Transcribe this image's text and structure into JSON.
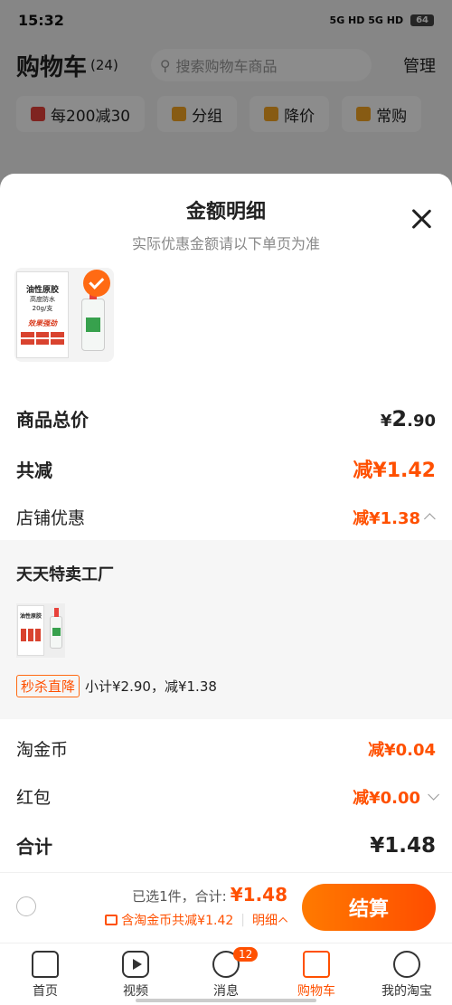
{
  "status": {
    "time": "15:32",
    "signal": "5G HD 5G HD",
    "battery": "64"
  },
  "background": {
    "title": "购物车",
    "count": "(24)",
    "search_placeholder": "搜索购物车商品",
    "manage_label": "管理",
    "chips": [
      "每200减30",
      "分组",
      "降价",
      "常购"
    ]
  },
  "sheet": {
    "title": "金额明细",
    "subtitle": "实际优惠金额请以下单页为准",
    "rows": {
      "total_label": "商品总价",
      "total_value_prefix": "¥",
      "total_value_int": "2",
      "total_value_dec": ".90",
      "reduce_label": "共减",
      "reduce_value": "减¥1.42",
      "shop_discount_label": "店铺优惠",
      "shop_discount_value": "减¥1.38",
      "coin_label": "淘金币",
      "coin_value": "减¥0.04",
      "hongbao_label": "红包",
      "hongbao_value": "减¥0.00",
      "sum_label": "合计",
      "sum_value": "¥1.48"
    },
    "product": {
      "title": "油性原胶",
      "subtitle": "高度防水",
      "size": "20g/支",
      "slogan": "效果强劲"
    },
    "store": {
      "name": "天天特卖工厂",
      "tag": "秒杀直降",
      "subtotal": "小计¥2.90，减¥1.38"
    }
  },
  "checkout": {
    "selected_text": "已选1件，合计:",
    "total": "¥1.48",
    "coin_text": "含淘金币共减¥1.42",
    "detail_label": "明细",
    "button_label": "结算"
  },
  "tabs": [
    {
      "label": "首页",
      "icon": "home-icon"
    },
    {
      "label": "视频",
      "icon": "video-icon"
    },
    {
      "label": "消息",
      "icon": "message-icon",
      "badge": "12"
    },
    {
      "label": "购物车",
      "icon": "cart-icon"
    },
    {
      "label": "我的淘宝",
      "icon": "profile-icon"
    }
  ],
  "colors": {
    "accent": "#ff5000",
    "overlay": "rgba(0,0,0,0.45)"
  }
}
